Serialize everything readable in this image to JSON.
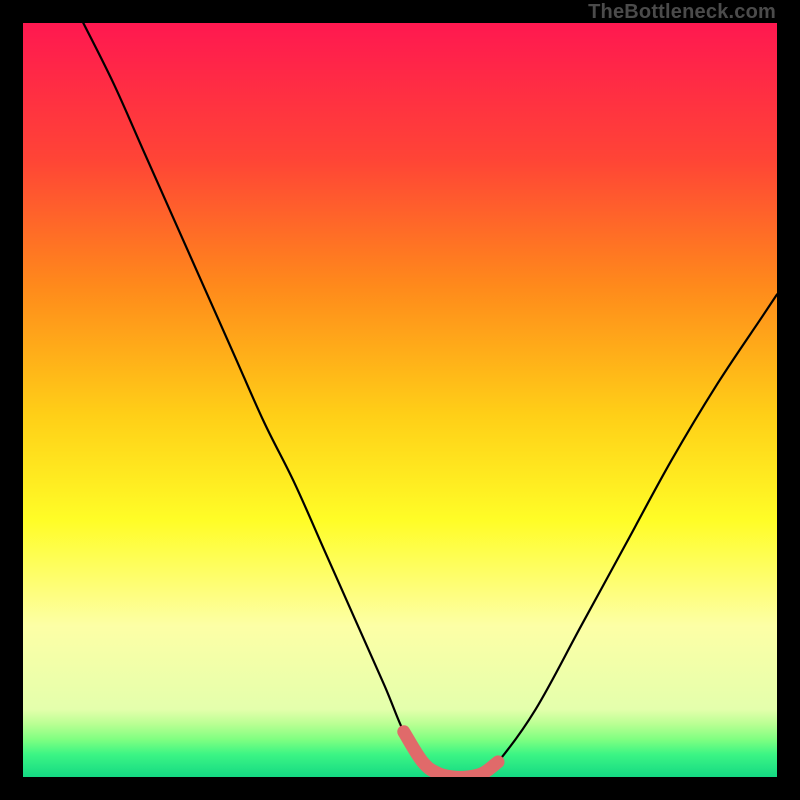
{
  "watermark": "TheBottleneck.com",
  "chart_data": {
    "type": "line",
    "title": "",
    "xlabel": "",
    "ylabel": "",
    "xlim": [
      0,
      100
    ],
    "ylim": [
      0,
      100
    ],
    "grid": false,
    "series": [
      {
        "name": "curve",
        "x": [
          8,
          12,
          16,
          20,
          24,
          28,
          32,
          36,
          40,
          44,
          48,
          50.5,
          53,
          55,
          57,
          59,
          61,
          63,
          68,
          74,
          80,
          86,
          92,
          98,
          100
        ],
        "y": [
          100,
          92,
          83,
          74,
          65,
          56,
          47,
          39,
          30,
          21,
          12,
          6,
          2,
          0.5,
          0,
          0,
          0.5,
          2,
          9,
          20,
          31,
          42,
          52,
          61,
          64
        ]
      },
      {
        "name": "highlight",
        "x": [
          50.5,
          53,
          55,
          57,
          59,
          61,
          63
        ],
        "y": [
          6,
          2,
          0.5,
          0,
          0,
          0.5,
          2
        ]
      }
    ],
    "gradient_stops": [
      {
        "pct": 0,
        "color": "#ff1850"
      },
      {
        "pct": 18,
        "color": "#ff4436"
      },
      {
        "pct": 35,
        "color": "#ff8a1b"
      },
      {
        "pct": 52,
        "color": "#ffcf17"
      },
      {
        "pct": 66,
        "color": "#fffd27"
      },
      {
        "pct": 80,
        "color": "#fdffa6"
      },
      {
        "pct": 91,
        "color": "#e4ffac"
      },
      {
        "pct": 93,
        "color": "#b9ff93"
      },
      {
        "pct": 95,
        "color": "#80ff81"
      },
      {
        "pct": 97,
        "color": "#3cf584"
      },
      {
        "pct": 100,
        "color": "#14d983"
      }
    ],
    "highlight_color": "#e06a6a"
  }
}
